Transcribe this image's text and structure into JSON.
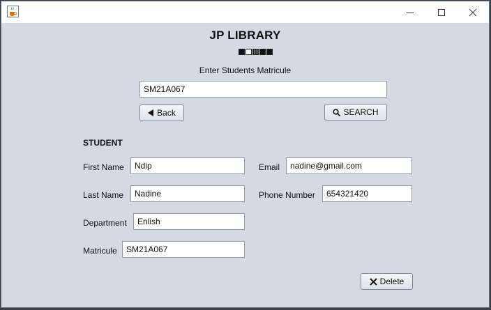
{
  "window": {
    "minimize_icon": "minimize-icon",
    "maximize_icon": "maximize-icon",
    "close_icon": "close-icon",
    "app_icon": "java-coffee-cup-icon"
  },
  "header": {
    "title": "JP LIBRARY",
    "prompt": "Enter Students Matricule"
  },
  "search": {
    "value": "SM21A067"
  },
  "buttons": {
    "back": "Back",
    "back_icon": "triangle-left-icon",
    "search": "SEARCH",
    "search_icon": "magnifier-icon",
    "delete": "Delete",
    "delete_icon": "x-icon"
  },
  "student": {
    "section_label": "STUDENT",
    "first_name_label": "First Name",
    "first_name": "Ndip",
    "last_name_label": "Last Name",
    "last_name": "Nadine",
    "department_label": "Department",
    "department": "Enlish",
    "matricule_label": "Matricule",
    "matricule": "SM21A067",
    "email_label": "Email",
    "email": "nadine@gmail.com",
    "phone_label": "Phone Number",
    "phone": "654321420"
  }
}
